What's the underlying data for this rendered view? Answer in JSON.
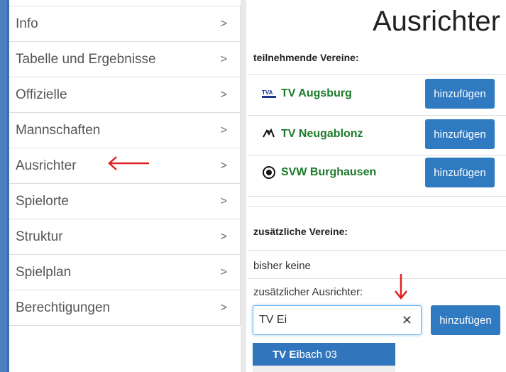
{
  "sidebar": {
    "items": [
      {
        "label": "Info",
        "chevron": ">"
      },
      {
        "label": "Tabelle und Ergebnisse",
        "chevron": ">"
      },
      {
        "label": "Offizielle",
        "chevron": ">"
      },
      {
        "label": "Mannschaften",
        "chevron": ">"
      },
      {
        "label": "Ausrichter",
        "chevron": ">"
      },
      {
        "label": "Spielorte",
        "chevron": ">"
      },
      {
        "label": "Struktur",
        "chevron": ">"
      },
      {
        "label": "Spielplan",
        "chevron": ">"
      },
      {
        "label": "Berechtigungen",
        "chevron": ">"
      }
    ]
  },
  "main": {
    "title": "Ausrichter",
    "participating_heading": "teilnehmende Vereine:",
    "clubs": [
      {
        "name": "TV Augsburg",
        "icon": "tv-augsburg-logo-icon",
        "button": "hinzufügen"
      },
      {
        "name": "TV Neugablonz",
        "icon": "tv-neugablonz-logo-icon",
        "button": "hinzufügen"
      },
      {
        "name": "SVW Burghausen",
        "icon": "svw-burghausen-logo-icon",
        "button": "hinzufügen"
      }
    ],
    "additional_heading": "zusätzliche Vereine:",
    "none_text": "bisher keine",
    "additional_organizer_label": "zusätzlicher Ausrichter:",
    "search_value": "TV Ei",
    "clear_symbol": "✕",
    "add_button": "hinzufügen",
    "suggestion_bold": "TV Ei",
    "suggestion_rest": "bach 03"
  },
  "colors": {
    "accent": "#2f7ac0",
    "club_name": "#1c7a2a",
    "annotation_red": "#e02020"
  }
}
